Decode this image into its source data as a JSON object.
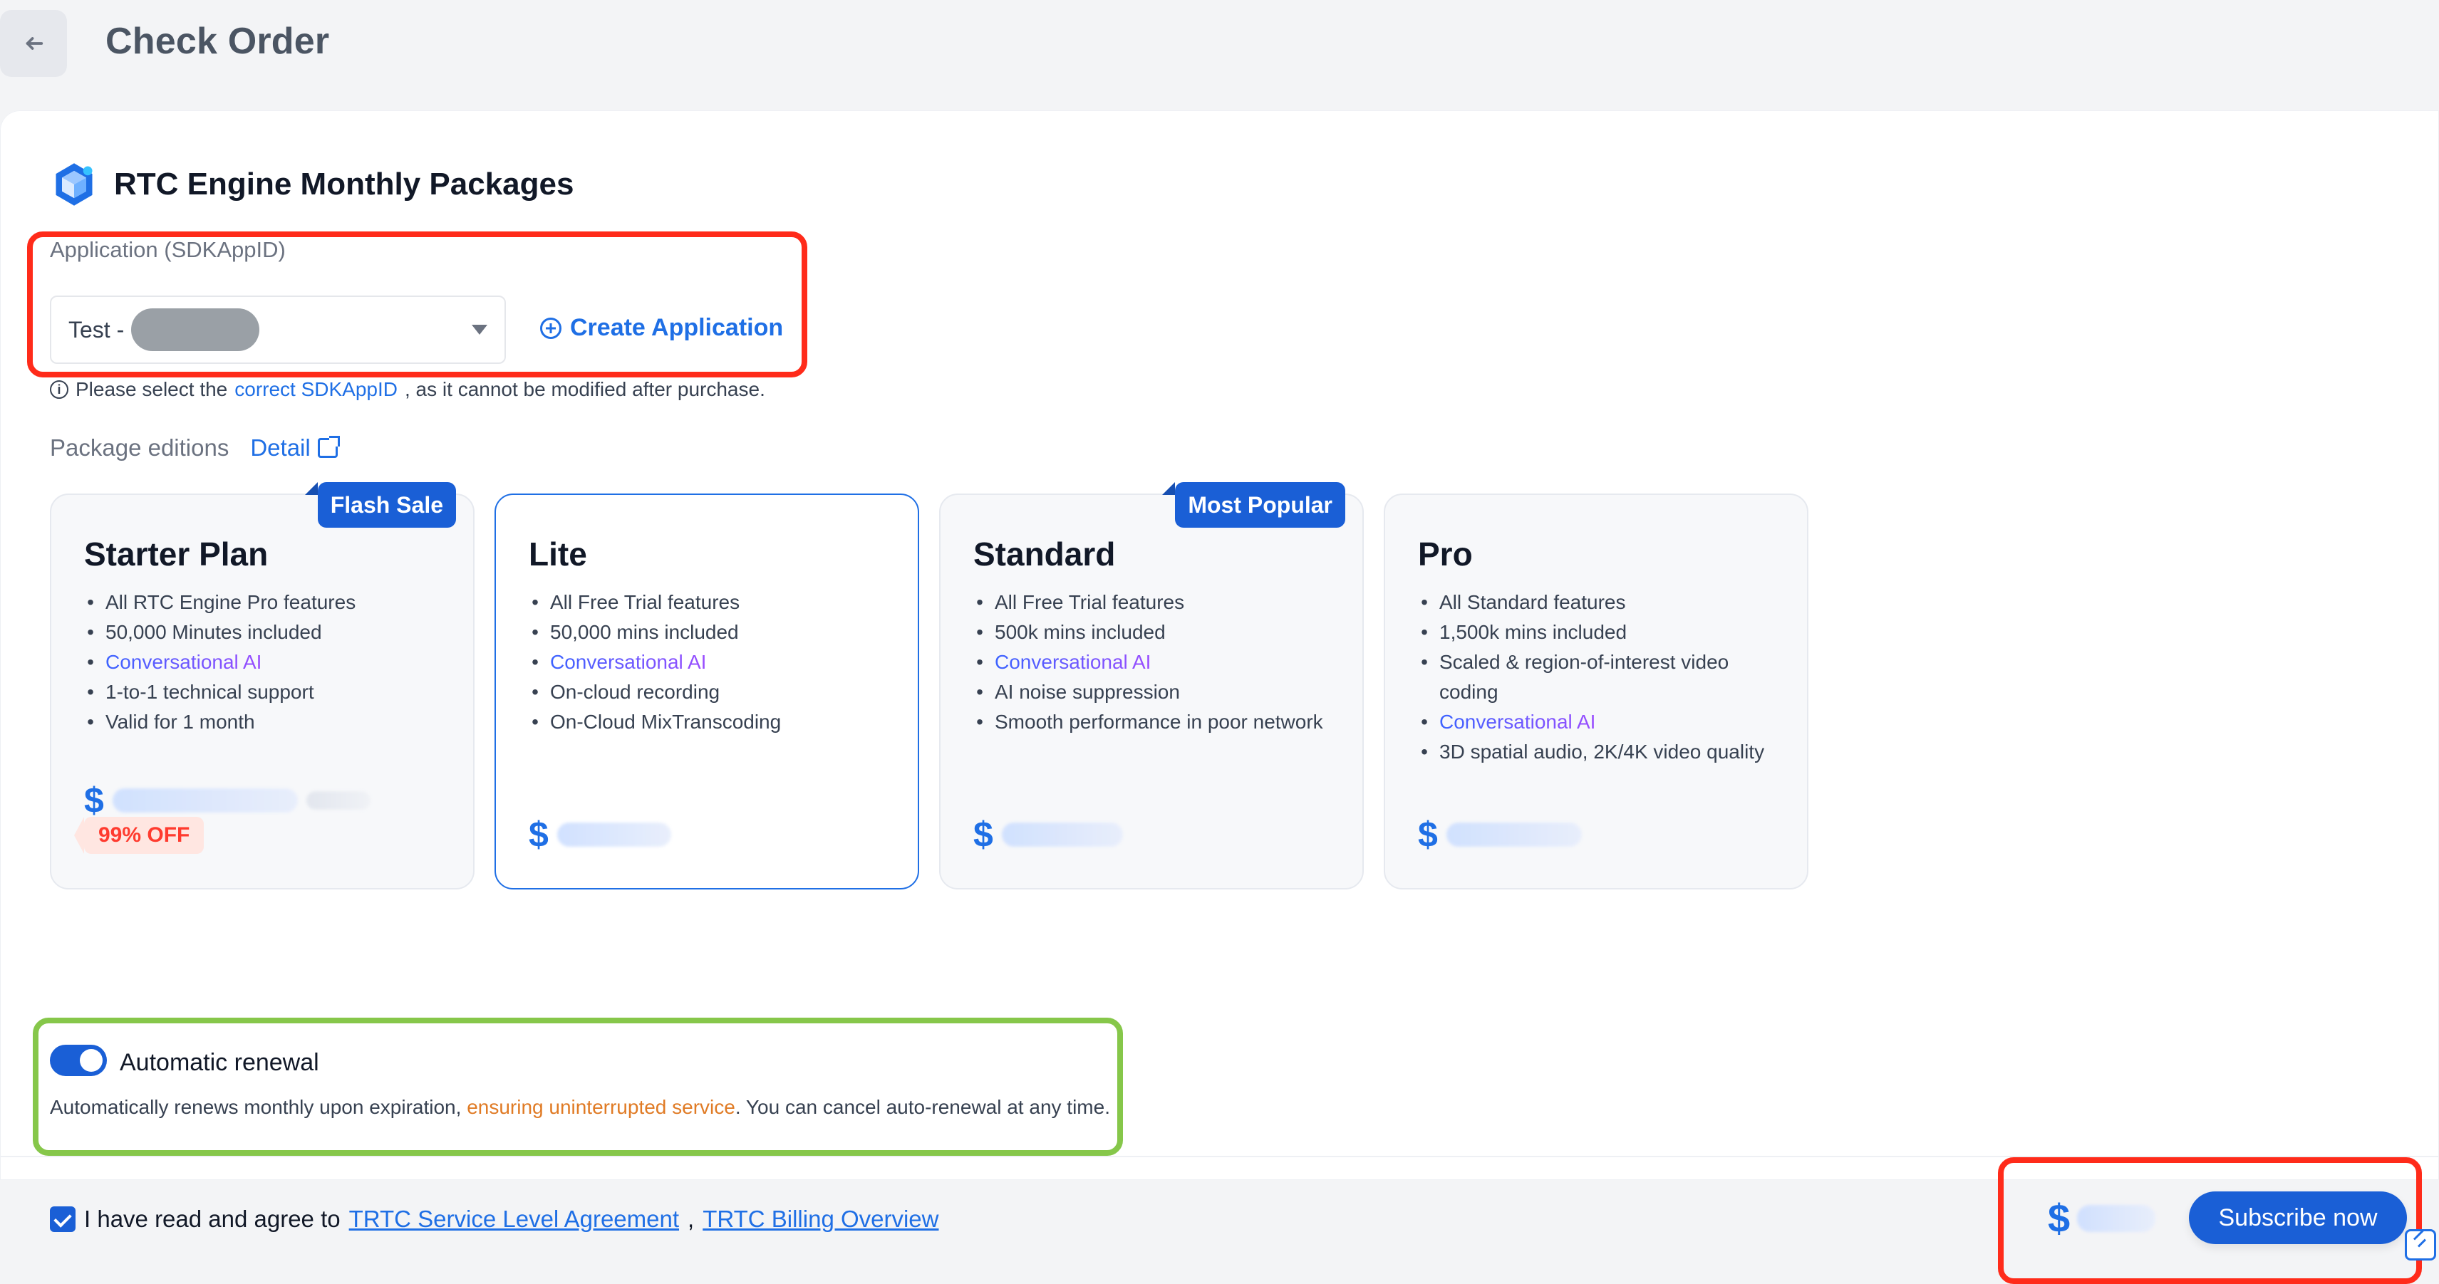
{
  "header": {
    "title": "Check Order",
    "back_icon": "back-arrow-icon"
  },
  "product": {
    "title": "RTC Engine Monthly Packages",
    "logo_icon": "cube-logo-icon"
  },
  "application": {
    "label": "Application (SDKAppID)",
    "selected_prefix": "Test -",
    "create_label": "Create Application",
    "note_prefix": "Please select the",
    "note_link": "correct SDKAppID",
    "note_suffix": ", as it cannot be modified after purchase."
  },
  "packages": {
    "label": "Package editions",
    "detail_label": "Detail",
    "cards": [
      {
        "name": "Starter Plan",
        "tag": "Flash Sale",
        "features": [
          "All RTC Engine Pro features",
          "50,000 Minutes included",
          "Conversational AI",
          "1-to-1 technical support",
          "Valid for 1 month"
        ],
        "price_symbol": "$",
        "discount": "99% OFF",
        "selected": false
      },
      {
        "name": "Lite",
        "tag": "",
        "features": [
          "All Free Trial features",
          "50,000 mins included",
          "Conversational AI",
          "On-cloud recording",
          "On-Cloud MixTranscoding"
        ],
        "price_symbol": "$",
        "selected": true
      },
      {
        "name": "Standard",
        "tag": "Most Popular",
        "features": [
          "All Free Trial features",
          "500k mins included",
          "Conversational AI",
          "AI noise suppression",
          "Smooth performance in poor network"
        ],
        "price_symbol": "$",
        "selected": false
      },
      {
        "name": "Pro",
        "tag": "",
        "features": [
          "All Standard features",
          "1,500k mins included",
          "Scaled & region-of-interest video coding",
          "Conversational AI",
          "3D spatial audio, 2K/4K video quality"
        ],
        "price_symbol": "$",
        "selected": false
      }
    ]
  },
  "renewal": {
    "title": "Automatic renewal",
    "enabled": true,
    "desc_prefix": "Automatically renews monthly upon expiration,",
    "desc_highlight": "ensuring uninterrupted service",
    "desc_suffix": ". You can cancel auto-renewal at any time."
  },
  "agreement": {
    "checked": true,
    "prefix": "I have read and agree to",
    "sla_link": "TRTC Service Level Agreement",
    "comma": ",",
    "billing_link": "TRTC Billing Overview"
  },
  "footer": {
    "price_symbol": "$",
    "subscribe_label": "Subscribe now",
    "corner_icon": "edit-icon"
  },
  "colors": {
    "accent": "#1f6fe5",
    "highlight_box": "#ff2b1a",
    "renewal_box": "#86c74a",
    "orange_text": "#e07b25"
  }
}
